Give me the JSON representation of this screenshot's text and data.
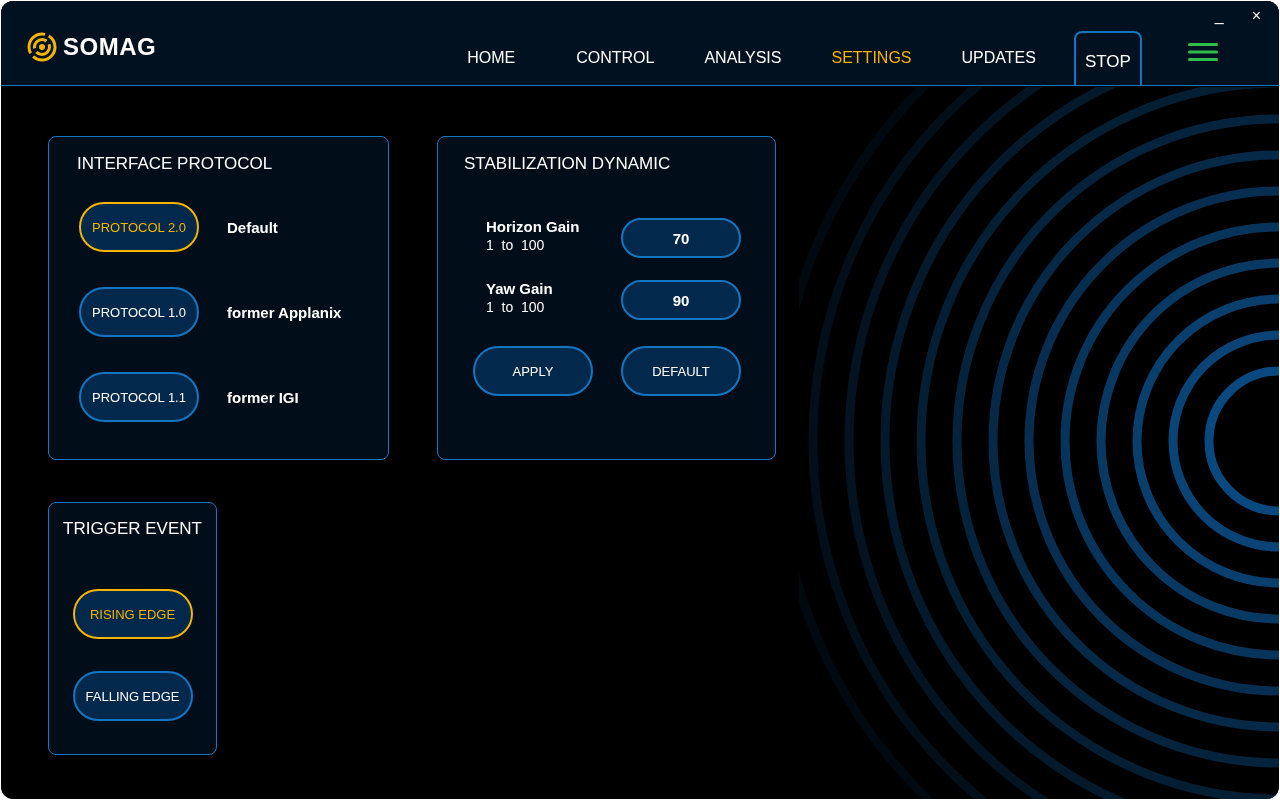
{
  "window_controls": [
    "_",
    "×"
  ],
  "logo": {
    "text": "SOMAG"
  },
  "nav": [
    {
      "label": "HOME",
      "selected": false
    },
    {
      "label": "CONTROL",
      "selected": false
    },
    {
      "label": "ANALYSIS",
      "selected": false
    },
    {
      "label": "SETTINGS",
      "selected": true
    },
    {
      "label": "UPDATES",
      "selected": false
    }
  ],
  "stop_button": {
    "label": "STOP"
  },
  "interface_protocol": {
    "title": "INTERFACE PROTOCOL",
    "options": [
      {
        "label": "PROTOCOL 2.0",
        "note": "Default",
        "selected": true
      },
      {
        "label": "PROTOCOL 1.0",
        "note": "former Applanix",
        "selected": false
      },
      {
        "label": "PROTOCOL 1.1",
        "note": "former IGI",
        "selected": false
      }
    ]
  },
  "stabilization_dynamic": {
    "title": "STABILIZATION DYNAMIC",
    "fields": [
      {
        "label": "Horizon Gain",
        "range": "1  to  100",
        "value": "70"
      },
      {
        "label": "Yaw Gain",
        "range": "1  to  100",
        "value": "90"
      }
    ],
    "buttons": [
      "APPLY",
      "DEFAULT"
    ]
  },
  "trigger_event": {
    "title": "TRIGGER EVENT",
    "options": [
      {
        "label": "RISING EDGE",
        "selected": true
      },
      {
        "label": "FALLING EDGE",
        "selected": false
      }
    ]
  }
}
